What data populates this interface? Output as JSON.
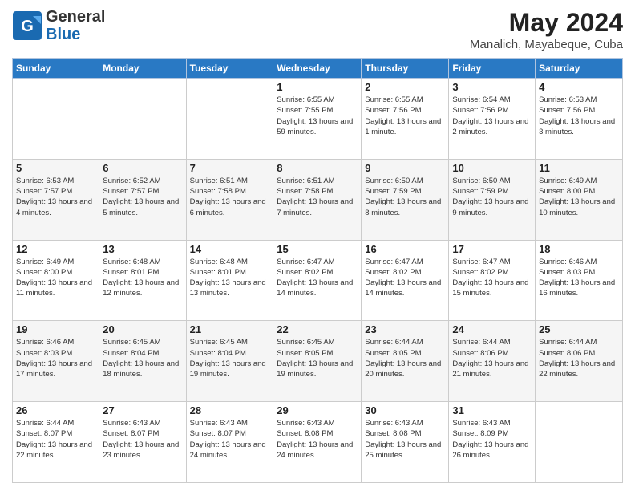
{
  "logo": {
    "general": "General",
    "blue": "Blue"
  },
  "header": {
    "month": "May 2024",
    "location": "Manalich, Mayabeque, Cuba"
  },
  "days_of_week": [
    "Sunday",
    "Monday",
    "Tuesday",
    "Wednesday",
    "Thursday",
    "Friday",
    "Saturday"
  ],
  "weeks": [
    [
      {
        "day": "",
        "info": ""
      },
      {
        "day": "",
        "info": ""
      },
      {
        "day": "",
        "info": ""
      },
      {
        "day": "1",
        "info": "Sunrise: 6:55 AM\nSunset: 7:55 PM\nDaylight: 13 hours and 59 minutes."
      },
      {
        "day": "2",
        "info": "Sunrise: 6:55 AM\nSunset: 7:56 PM\nDaylight: 13 hours and 1 minute."
      },
      {
        "day": "3",
        "info": "Sunrise: 6:54 AM\nSunset: 7:56 PM\nDaylight: 13 hours and 2 minutes."
      },
      {
        "day": "4",
        "info": "Sunrise: 6:53 AM\nSunset: 7:56 PM\nDaylight: 13 hours and 3 minutes."
      }
    ],
    [
      {
        "day": "5",
        "info": "Sunrise: 6:53 AM\nSunset: 7:57 PM\nDaylight: 13 hours and 4 minutes."
      },
      {
        "day": "6",
        "info": "Sunrise: 6:52 AM\nSunset: 7:57 PM\nDaylight: 13 hours and 5 minutes."
      },
      {
        "day": "7",
        "info": "Sunrise: 6:51 AM\nSunset: 7:58 PM\nDaylight: 13 hours and 6 minutes."
      },
      {
        "day": "8",
        "info": "Sunrise: 6:51 AM\nSunset: 7:58 PM\nDaylight: 13 hours and 7 minutes."
      },
      {
        "day": "9",
        "info": "Sunrise: 6:50 AM\nSunset: 7:59 PM\nDaylight: 13 hours and 8 minutes."
      },
      {
        "day": "10",
        "info": "Sunrise: 6:50 AM\nSunset: 7:59 PM\nDaylight: 13 hours and 9 minutes."
      },
      {
        "day": "11",
        "info": "Sunrise: 6:49 AM\nSunset: 8:00 PM\nDaylight: 13 hours and 10 minutes."
      }
    ],
    [
      {
        "day": "12",
        "info": "Sunrise: 6:49 AM\nSunset: 8:00 PM\nDaylight: 13 hours and 11 minutes."
      },
      {
        "day": "13",
        "info": "Sunrise: 6:48 AM\nSunset: 8:01 PM\nDaylight: 13 hours and 12 minutes."
      },
      {
        "day": "14",
        "info": "Sunrise: 6:48 AM\nSunset: 8:01 PM\nDaylight: 13 hours and 13 minutes."
      },
      {
        "day": "15",
        "info": "Sunrise: 6:47 AM\nSunset: 8:02 PM\nDaylight: 13 hours and 14 minutes."
      },
      {
        "day": "16",
        "info": "Sunrise: 6:47 AM\nSunset: 8:02 PM\nDaylight: 13 hours and 14 minutes."
      },
      {
        "day": "17",
        "info": "Sunrise: 6:47 AM\nSunset: 8:02 PM\nDaylight: 13 hours and 15 minutes."
      },
      {
        "day": "18",
        "info": "Sunrise: 6:46 AM\nSunset: 8:03 PM\nDaylight: 13 hours and 16 minutes."
      }
    ],
    [
      {
        "day": "19",
        "info": "Sunrise: 6:46 AM\nSunset: 8:03 PM\nDaylight: 13 hours and 17 minutes."
      },
      {
        "day": "20",
        "info": "Sunrise: 6:45 AM\nSunset: 8:04 PM\nDaylight: 13 hours and 18 minutes."
      },
      {
        "day": "21",
        "info": "Sunrise: 6:45 AM\nSunset: 8:04 PM\nDaylight: 13 hours and 19 minutes."
      },
      {
        "day": "22",
        "info": "Sunrise: 6:45 AM\nSunset: 8:05 PM\nDaylight: 13 hours and 19 minutes."
      },
      {
        "day": "23",
        "info": "Sunrise: 6:44 AM\nSunset: 8:05 PM\nDaylight: 13 hours and 20 minutes."
      },
      {
        "day": "24",
        "info": "Sunrise: 6:44 AM\nSunset: 8:06 PM\nDaylight: 13 hours and 21 minutes."
      },
      {
        "day": "25",
        "info": "Sunrise: 6:44 AM\nSunset: 8:06 PM\nDaylight: 13 hours and 22 minutes."
      }
    ],
    [
      {
        "day": "26",
        "info": "Sunrise: 6:44 AM\nSunset: 8:07 PM\nDaylight: 13 hours and 22 minutes."
      },
      {
        "day": "27",
        "info": "Sunrise: 6:43 AM\nSunset: 8:07 PM\nDaylight: 13 hours and 23 minutes."
      },
      {
        "day": "28",
        "info": "Sunrise: 6:43 AM\nSunset: 8:07 PM\nDaylight: 13 hours and 24 minutes."
      },
      {
        "day": "29",
        "info": "Sunrise: 6:43 AM\nSunset: 8:08 PM\nDaylight: 13 hours and 24 minutes."
      },
      {
        "day": "30",
        "info": "Sunrise: 6:43 AM\nSunset: 8:08 PM\nDaylight: 13 hours and 25 minutes."
      },
      {
        "day": "31",
        "info": "Sunrise: 6:43 AM\nSunset: 8:09 PM\nDaylight: 13 hours and 26 minutes."
      },
      {
        "day": "",
        "info": ""
      }
    ]
  ]
}
